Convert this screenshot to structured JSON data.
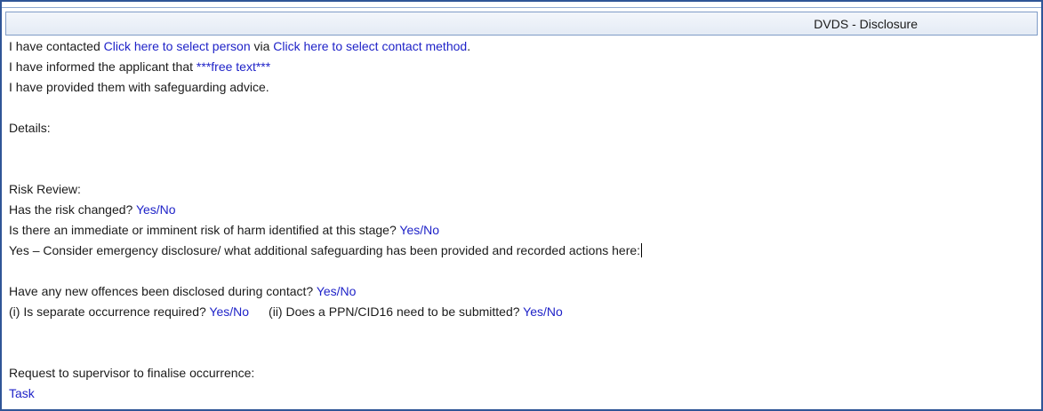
{
  "header": {
    "title": "DVDS - Disclosure"
  },
  "form": {
    "line1": {
      "prefix": "I have contacted ",
      "person_link": "Click here to select person",
      "middle": " via ",
      "method_link": "Click here to select contact method",
      "suffix": "."
    },
    "line2": {
      "prefix": "I have informed the applicant that ",
      "free_text": "***free text***"
    },
    "line3": "I have provided them with safeguarding advice.",
    "details_label": "Details:",
    "risk_review_label": "Risk Review:",
    "risk_changed": {
      "question": "Has the risk changed? ",
      "answer": "Yes/No"
    },
    "imminent_risk": {
      "question": "Is there an immediate or imminent risk of harm identified at this stage? ",
      "answer": "Yes/No"
    },
    "yes_consider": "Yes – Consider emergency disclosure/ what additional safeguarding has been provided and recorded actions here:",
    "new_offences": {
      "question": "Have any new offences been disclosed during contact? ",
      "answer": "Yes/No"
    },
    "separate_occurrence": {
      "question": "(i) Is separate occurrence required? ",
      "answer": "Yes/No"
    },
    "ppn": {
      "question": "(ii) Does a PPN/CID16 need to be submitted? ",
      "answer": "Yes/No"
    },
    "supervisor_label": "Request to supervisor to finalise occurrence:",
    "task_link": "Task"
  }
}
